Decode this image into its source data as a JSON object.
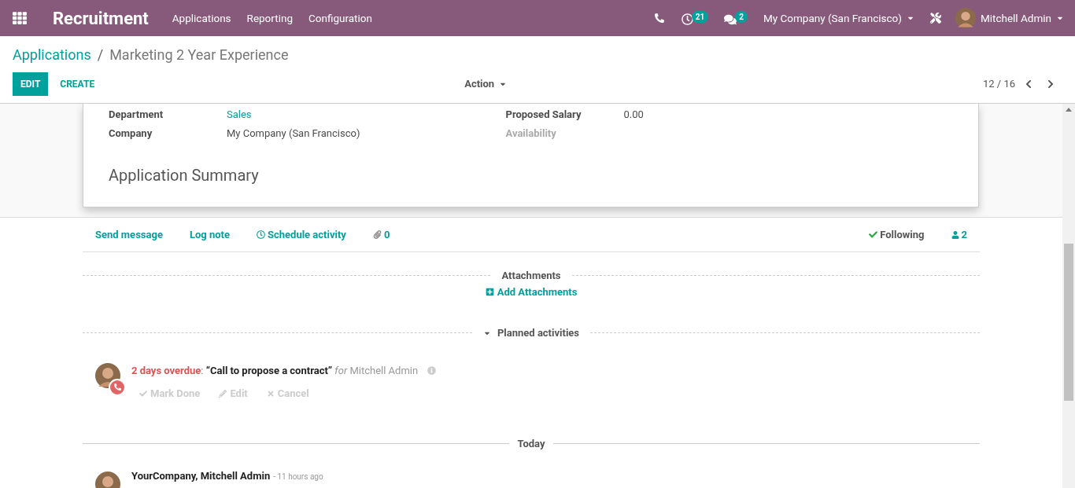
{
  "navbar": {
    "app_name": "Recruitment",
    "menu": [
      "Applications",
      "Reporting",
      "Configuration"
    ],
    "activity_count": "21",
    "message_count": "2",
    "company": "My Company (San Francisco)",
    "user": "Mitchell Admin"
  },
  "breadcrumb": {
    "parent": "Applications",
    "separator": "/",
    "current": "Marketing 2 Year Experience"
  },
  "control_panel": {
    "buttons": [
      "EDIT",
      "CREATE"
    ],
    "action": "Action",
    "pager": "12 / 16"
  },
  "form": {
    "left_fields": [
      {
        "label": "Department",
        "value": "Sales",
        "kind": "link"
      },
      {
        "label": "Company",
        "value": "My Company (San Francisco)",
        "kind": "text"
      }
    ],
    "right_fields": [
      {
        "label": "Proposed Salary",
        "value": "0.00",
        "disabled": false
      },
      {
        "label": "Availability",
        "disabled": true
      }
    ],
    "section_title": "Application Summary"
  },
  "chatter": {
    "topbar": {
      "send_message": "Send message",
      "log_note": "Log note",
      "schedule_activity": "Schedule activity",
      "attachment_count": "0",
      "following": "Following",
      "follower_count": "2"
    },
    "attachments": {
      "title": "Attachments",
      "add": "Add Attachments"
    },
    "planned": {
      "title": "Planned activities",
      "expanded": true,
      "activities": [
        {
          "due": "2 days overdue",
          "colon": ":",
          "summary": "“Call to propose a contract”",
          "for": "for",
          "assignee": "Mitchell Admin",
          "actions": [
            "Mark Done",
            "Edit",
            "Cancel"
          ]
        }
      ]
    },
    "today": "Today",
    "messages": [
      {
        "author": "YourCompany, Mitchell Admin",
        "time": "- 11 hours ago"
      }
    ]
  }
}
